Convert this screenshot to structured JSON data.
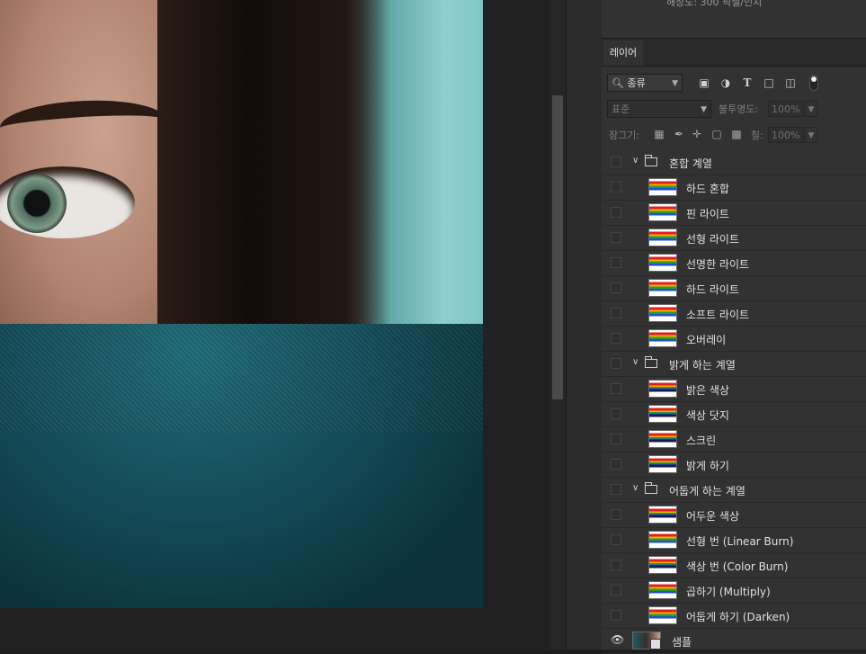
{
  "top_panel": {
    "text": "해상도: 300 픽셀/인치"
  },
  "layers_panel": {
    "tab_label": "레이어",
    "filter_kind": "종류",
    "blend_mode": "표준",
    "opacity_label": "불투명도:",
    "opacity_value": "100%",
    "lock_label": "잠그기:",
    "fill_label": "칠:",
    "fill_value": "100%",
    "layers": [
      {
        "type": "group",
        "name": "혼합 계열",
        "visible": false
      },
      {
        "type": "layer",
        "name": "하드 혼합",
        "visible": false,
        "thumb": "light"
      },
      {
        "type": "layer",
        "name": "핀 라이트",
        "visible": false,
        "thumb": "light"
      },
      {
        "type": "layer",
        "name": "선형 라이트",
        "visible": false,
        "thumb": "light"
      },
      {
        "type": "layer",
        "name": "선명한 라이트",
        "visible": false,
        "thumb": "light"
      },
      {
        "type": "layer",
        "name": "하드 라이트",
        "visible": false,
        "thumb": "light"
      },
      {
        "type": "layer",
        "name": "소프트 라이트",
        "visible": false,
        "thumb": "light"
      },
      {
        "type": "layer",
        "name": "오버레이",
        "visible": false,
        "thumb": "light"
      },
      {
        "type": "group",
        "name": "밝게 하는 계열",
        "visible": false
      },
      {
        "type": "layer",
        "name": "밝은 색상",
        "visible": false,
        "thumb": "dark"
      },
      {
        "type": "layer",
        "name": "색상 닷지",
        "visible": false,
        "thumb": "dark"
      },
      {
        "type": "layer",
        "name": "스크린",
        "visible": false,
        "thumb": "dark"
      },
      {
        "type": "layer",
        "name": "밝게 하기",
        "visible": false,
        "thumb": "dark"
      },
      {
        "type": "group",
        "name": "어둡게 하는 계열",
        "visible": false
      },
      {
        "type": "layer",
        "name": "어두운 색상",
        "visible": false,
        "thumb": "dark"
      },
      {
        "type": "layer",
        "name": "선형 번 (Linear Burn)",
        "visible": false,
        "thumb": "light"
      },
      {
        "type": "layer",
        "name": "색상 번 (Color Burn)",
        "visible": false,
        "thumb": "dark"
      },
      {
        "type": "layer",
        "name": "곱하기 (Multiply)",
        "visible": false,
        "thumb": "light"
      },
      {
        "type": "layer",
        "name": "어둡게 하기 (Darken)",
        "visible": false,
        "thumb": "light"
      },
      {
        "type": "layer",
        "name": "샘플",
        "visible": true,
        "thumb": "photo"
      }
    ]
  }
}
